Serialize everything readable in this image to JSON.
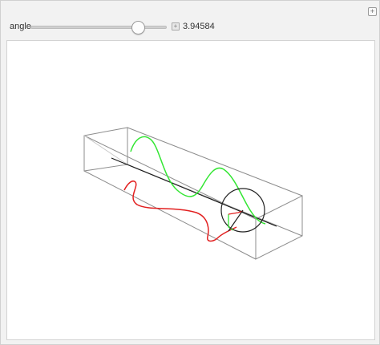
{
  "controls": {
    "angle_label": "angle",
    "angle_value": "3.94584"
  },
  "icons": {
    "corner_plus": "plus-icon",
    "slider_plus": "plus-icon"
  },
  "colors": {
    "wave_upper": "#33e633",
    "wave_lower": "#e22020",
    "box_edges": "#8c8c8c",
    "axis_line": "#111111",
    "circle": "#222222"
  }
}
